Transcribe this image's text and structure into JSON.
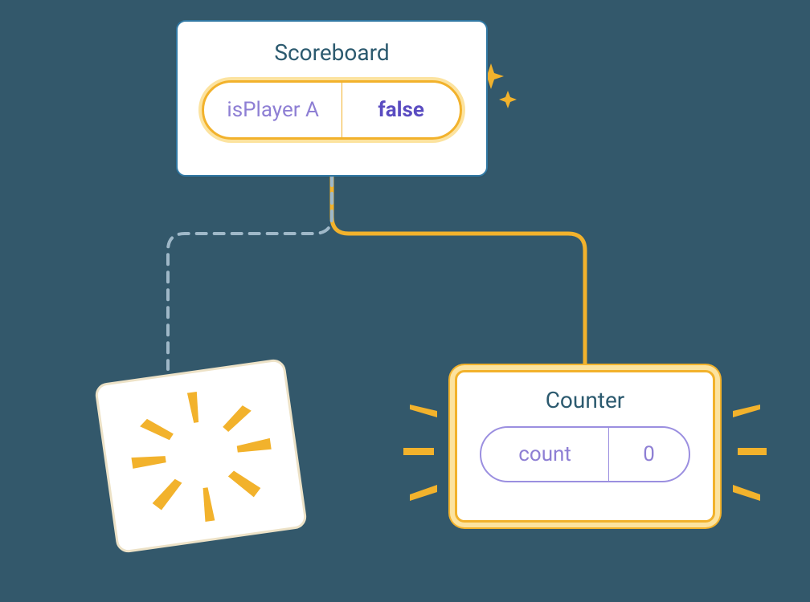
{
  "scoreboard": {
    "title": "Scoreboard",
    "state_key": "isPlayer A",
    "state_value": "false"
  },
  "counter": {
    "title": "Counter",
    "state_key": "count",
    "state_value": "0"
  },
  "colors": {
    "accent_orange": "#f2b22c",
    "accent_purple": "#8e7fd4",
    "title_teal": "#2c5a6f"
  }
}
